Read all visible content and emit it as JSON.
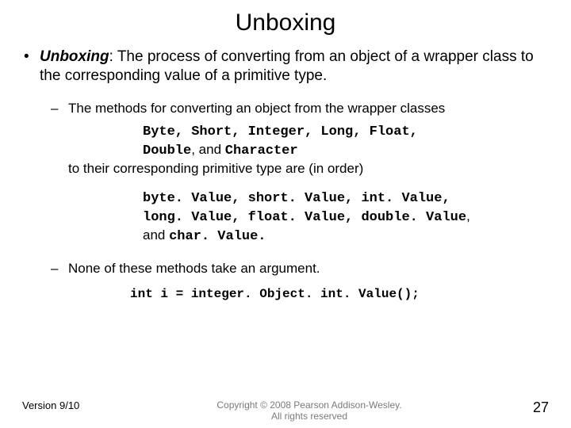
{
  "title": "Unboxing",
  "definition": {
    "term": "Unboxing",
    "text": ":  The process of converting from an object of a wrapper class to the corresponding value of a primitive type."
  },
  "sub1": {
    "lead": "The methods for converting an object from the wrapper classes",
    "classes_line1": "Byte, Short, Integer, Long, Float,",
    "classes_line2_pre": "Double",
    "classes_line2_mid": ", and ",
    "classes_line2_post": "Character",
    "tail": "to their corresponding primitive type are (in order)"
  },
  "methods": {
    "line1": "byte. Value, short. Value, int. Value,",
    "line2_a": "long. Value, float. Value, double. Value",
    "line2_b": ",",
    "line3_pre": "and ",
    "line3_code": "char. Value."
  },
  "sub2": "None of these methods take an argument.",
  "code_example": "int i = integer. Object. int. Value();",
  "footer": {
    "version": "Version 9/10",
    "copyright_l1": "Copyright © 2008 Pearson Addison-Wesley.",
    "copyright_l2": "All rights reserved",
    "page": "27"
  }
}
